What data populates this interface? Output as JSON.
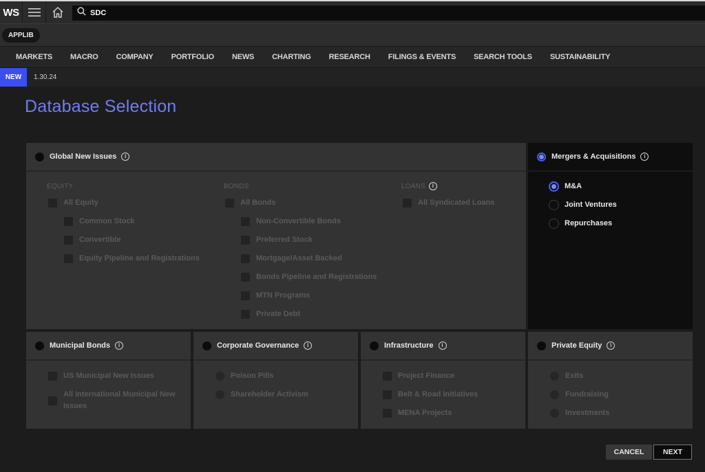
{
  "app": {
    "logo": "WS"
  },
  "search": {
    "value": "SDC"
  },
  "applib_label": "APPLIB",
  "nav": {
    "items": [
      "MARKETS",
      "MACRO",
      "COMPANY",
      "PORTFOLIO",
      "NEWS",
      "CHARTING",
      "RESEARCH",
      "FILINGS & EVENTS",
      "SEARCH TOOLS",
      "SUSTAINABILITY"
    ]
  },
  "release": {
    "badge": "NEW",
    "date": "1.30.24"
  },
  "page_title": "Database Selection",
  "databases": {
    "global_new_issues": {
      "title": "Global New Issues",
      "selected": false,
      "columns": {
        "equity": {
          "heading": "EQUITY",
          "items": [
            "All Equity",
            "Common Stock",
            "Convertible",
            "Equity Pipeline and Registrations"
          ]
        },
        "bonds": {
          "heading": "BONDS",
          "items": [
            "All Bonds",
            "Non-Convertible Bonds",
            "Preferred Stock",
            "Mortgage/Asset Backed",
            "Bonds Pipeline and Registrations",
            "MTN Programs",
            "Private Debt"
          ]
        },
        "loans": {
          "heading": "LOANS",
          "items": [
            "All Syndicated Loans"
          ]
        }
      }
    },
    "mergers_acquisitions": {
      "title": "Mergers & Acquisitions",
      "selected": true,
      "options": [
        "M&A",
        "Joint Ventures",
        "Repurchases"
      ],
      "selected_option": "M&A"
    },
    "municipal_bonds": {
      "title": "Municipal Bonds",
      "selected": false,
      "items": [
        "US Municipal New Issues",
        "All International Municipal New Issues"
      ]
    },
    "corporate_governance": {
      "title": "Corporate Governance",
      "selected": false,
      "options": [
        "Poison Pills",
        "Shareholder Activism"
      ]
    },
    "infrastructure": {
      "title": "Infrastructure",
      "selected": false,
      "items": [
        "Project Finance",
        "Belt & Road Initiatives",
        "MENA Projects"
      ]
    },
    "private_equity": {
      "title": "Private Equity",
      "selected": false,
      "options": [
        "Exits",
        "Fundraising",
        "Investments"
      ]
    }
  },
  "icons": {
    "info": "i"
  },
  "buttons": {
    "cancel": "CANCEL",
    "next": "NEXT"
  }
}
